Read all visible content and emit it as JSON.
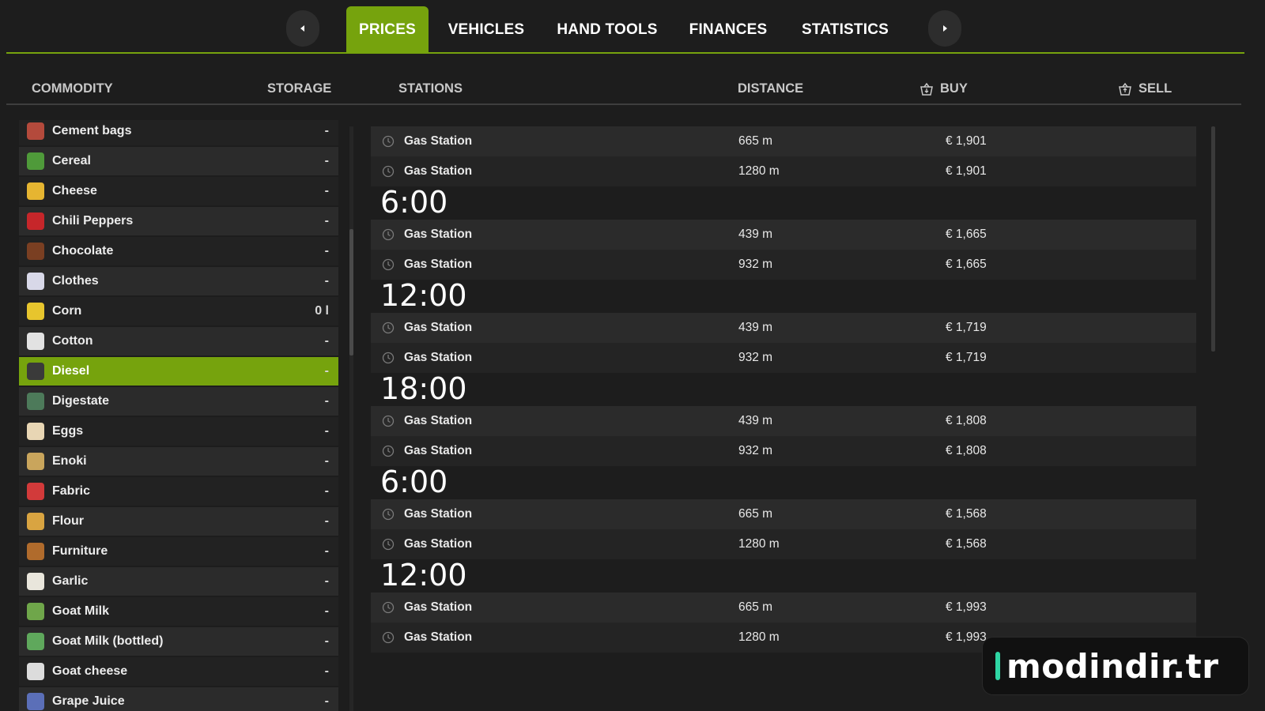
{
  "tabs": {
    "items": [
      {
        "label": "PRICES",
        "active": true
      },
      {
        "label": "VEHICLES",
        "active": false
      },
      {
        "label": "HAND TOOLS",
        "active": false
      },
      {
        "label": "FINANCES",
        "active": false
      },
      {
        "label": "STATISTICS",
        "active": false
      }
    ],
    "prev_icon": "caret-left-icon",
    "next_icon": "caret-right-icon"
  },
  "columns": {
    "commodity": "COMMODITY",
    "storage": "STORAGE",
    "stations": "STATIONS",
    "distance": "DISTANCE",
    "buy": "BUY",
    "sell": "SELL"
  },
  "commodities": [
    {
      "name": "Cement bags",
      "storage": "-",
      "icon": "cement-bags-icon",
      "color": "#b44a3c"
    },
    {
      "name": "Cereal",
      "storage": "-",
      "icon": "cereal-icon",
      "color": "#4f9a3a"
    },
    {
      "name": "Cheese",
      "storage": "-",
      "icon": "cheese-icon",
      "color": "#e6b531"
    },
    {
      "name": "Chili Peppers",
      "storage": "-",
      "icon": "chili-pepper-icon",
      "color": "#c6262a"
    },
    {
      "name": "Chocolate",
      "storage": "-",
      "icon": "chocolate-icon",
      "color": "#7a3f22"
    },
    {
      "name": "Clothes",
      "storage": "-",
      "icon": "clothes-icon",
      "color": "#d8d8e8"
    },
    {
      "name": "Corn",
      "storage": "0 l",
      "icon": "corn-icon",
      "color": "#e7c52d"
    },
    {
      "name": "Cotton",
      "storage": "-",
      "icon": "cotton-icon",
      "color": "#e2e2e2"
    },
    {
      "name": "Diesel",
      "storage": "-",
      "icon": "diesel-icon",
      "color": "#3a3a3a",
      "selected": true
    },
    {
      "name": "Digestate",
      "storage": "-",
      "icon": "digestate-icon",
      "color": "#4d7a5a"
    },
    {
      "name": "Eggs",
      "storage": "-",
      "icon": "eggs-icon",
      "color": "#e8d6b4"
    },
    {
      "name": "Enoki",
      "storage": "-",
      "icon": "enoki-icon",
      "color": "#c9a55c"
    },
    {
      "name": "Fabric",
      "storage": "-",
      "icon": "fabric-icon",
      "color": "#d23a3a"
    },
    {
      "name": "Flour",
      "storage": "-",
      "icon": "flour-icon",
      "color": "#d9a441"
    },
    {
      "name": "Furniture",
      "storage": "-",
      "icon": "furniture-icon",
      "color": "#b06b2c"
    },
    {
      "name": "Garlic",
      "storage": "-",
      "icon": "garlic-icon",
      "color": "#e9e6dc"
    },
    {
      "name": "Goat Milk",
      "storage": "-",
      "icon": "goat-milk-icon",
      "color": "#6fa64a"
    },
    {
      "name": "Goat Milk (bottled)",
      "storage": "-",
      "icon": "goat-milk-bottle-icon",
      "color": "#5fa85c"
    },
    {
      "name": "Goat cheese",
      "storage": "-",
      "icon": "goat-cheese-icon",
      "color": "#dcdcdc"
    },
    {
      "name": "Grape Juice",
      "storage": "-",
      "icon": "grape-juice-icon",
      "color": "#5b6fb8"
    }
  ],
  "stations": [
    {
      "name": "Gas Station",
      "distance": "665 m",
      "buy": "€ 1,901"
    },
    {
      "name": "Gas Station",
      "distance": "1280 m",
      "buy": "€ 1,901"
    },
    {
      "time": "6:00"
    },
    {
      "name": "Gas Station",
      "distance": "439 m",
      "buy": "€ 1,665"
    },
    {
      "name": "Gas Station",
      "distance": "932 m",
      "buy": "€ 1,665"
    },
    {
      "time": "12:00"
    },
    {
      "name": "Gas Station",
      "distance": "439 m",
      "buy": "€ 1,719"
    },
    {
      "name": "Gas Station",
      "distance": "932 m",
      "buy": "€ 1,719"
    },
    {
      "time": "18:00"
    },
    {
      "name": "Gas Station",
      "distance": "439 m",
      "buy": "€ 1,808"
    },
    {
      "name": "Gas Station",
      "distance": "932 m",
      "buy": "€ 1,808"
    },
    {
      "time": "6:00"
    },
    {
      "name": "Gas Station",
      "distance": "665 m",
      "buy": "€ 1,568"
    },
    {
      "name": "Gas Station",
      "distance": "1280 m",
      "buy": "€ 1,568"
    },
    {
      "time": "12:00"
    },
    {
      "name": "Gas Station",
      "distance": "665 m",
      "buy": "€ 1,993"
    },
    {
      "name": "Gas Station",
      "distance": "1280 m",
      "buy": "€ 1,993"
    }
  ],
  "watermark": {
    "text": "modindir.tr"
  },
  "colors": {
    "accent": "#76a30d",
    "background": "#1d1d1d",
    "row_dark": "#242424",
    "row_light": "#2b2b2b"
  }
}
